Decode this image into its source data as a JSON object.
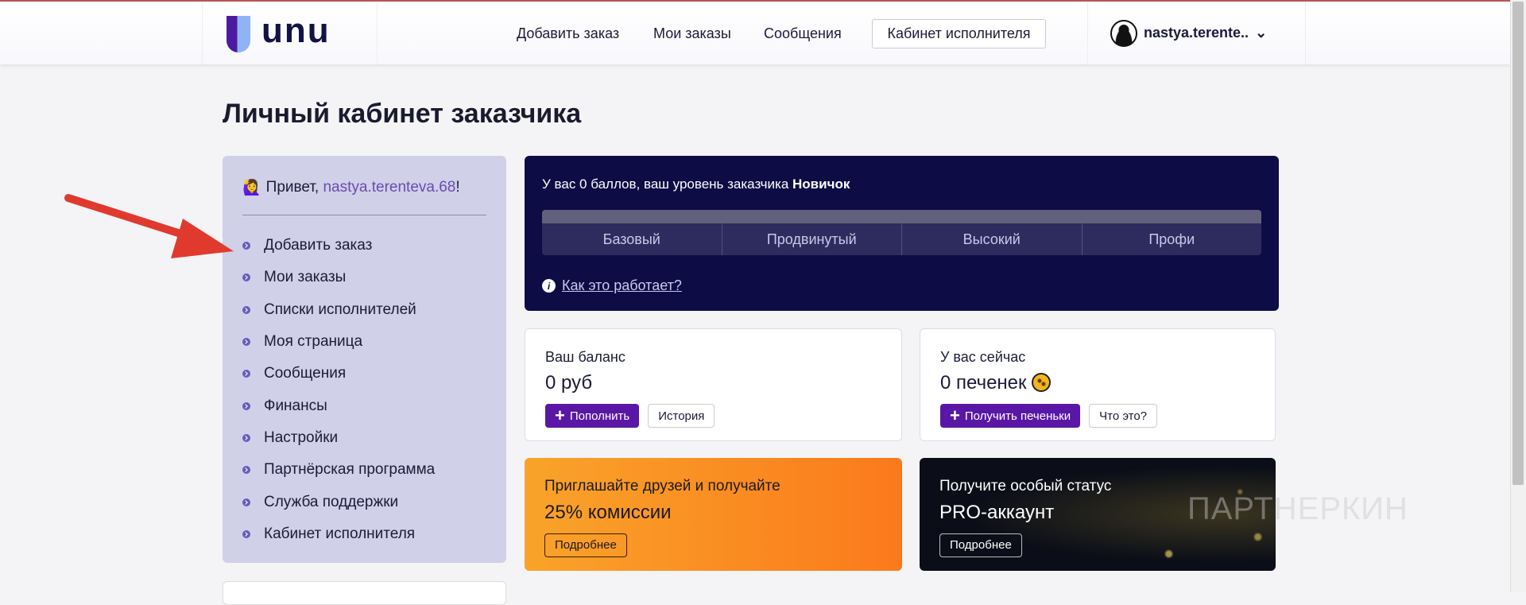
{
  "header": {
    "logo": "unu",
    "nav": [
      "Добавить заказ",
      "Мои заказы",
      "Сообщения"
    ],
    "executor_button": "Кабинет исполнителя",
    "username": "nastya.terente..",
    "chevron": "⌄"
  },
  "page_title": "Личный кабинет заказчика",
  "sidebar": {
    "greeting": "Привет, ",
    "username": "nastya.terenteva.68",
    "exclaim": "!",
    "emoji": "🙋‍♀️",
    "items": [
      "Добавить заказ",
      "Мои заказы",
      "Списки исполнителей",
      "Моя страница",
      "Сообщения",
      "Финансы",
      "Настройки",
      "Партнёрская программа",
      "Служба поддержки",
      "Кабинет исполнителя"
    ]
  },
  "level": {
    "text": "У вас 0 баллов, ваш уровень заказчика ",
    "level_name": "Новичок",
    "progress": 0,
    "levels": [
      "Базовый",
      "Продвинутый",
      "Высокий",
      "Профи"
    ],
    "how_link": "Как это работает?"
  },
  "balance": {
    "label": "Ваш баланс",
    "value": "0 руб",
    "topup": "Пополнить",
    "history": "История"
  },
  "cookies": {
    "label": "У вас сейчас",
    "value": "0 печенек",
    "get": "Получить печеньки",
    "what": "Что это?"
  },
  "promo_ref": {
    "line1": "Приглашайте друзей и получайте",
    "line2": "25% комиссии",
    "button": "Подробнее"
  },
  "promo_pro": {
    "line1": "Получите особый статус",
    "line2": "PRO-аккаунт",
    "button": "Подробнее"
  },
  "watermark": "ПАРТНЕРКИН"
}
